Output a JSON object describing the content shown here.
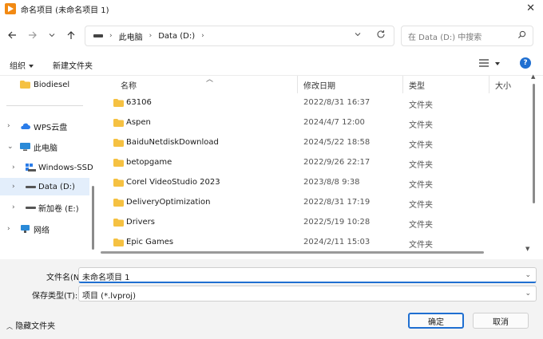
{
  "window": {
    "title": "命名项目 (未命名项目 1)"
  },
  "address_bar": {
    "breadcrumbs": [
      "此电脑",
      "Data (D:)"
    ]
  },
  "search": {
    "placeholder": "在 Data (D:) 中搜索"
  },
  "toolbar": {
    "organize_label": "组织",
    "new_folder_label": "新建文件夹"
  },
  "sidebar": {
    "items": [
      {
        "label": "Biodiesel",
        "icon": "folder-icon",
        "expandable": false
      },
      {
        "label": "WPS云盘",
        "icon": "cloud-icon",
        "expandable": true
      },
      {
        "label": "此电脑",
        "icon": "computer-icon",
        "expandable": true,
        "expanded": true
      },
      {
        "label": "Windows-SSD",
        "icon": "windows-drive-icon",
        "expandable": true
      },
      {
        "label": "Data (D:)",
        "icon": "drive-icon",
        "expandable": true,
        "selected": true
      },
      {
        "label": "新加卷 (E:)",
        "icon": "drive-icon",
        "expandable": true
      },
      {
        "label": "网络",
        "icon": "network-icon",
        "expandable": true
      }
    ]
  },
  "file_list": {
    "columns": [
      "名称",
      "修改日期",
      "类型",
      "大小"
    ],
    "rows": [
      {
        "name": "63106",
        "date": "2022/8/31 16:37",
        "type": "文件夹"
      },
      {
        "name": "Aspen",
        "date": "2024/4/7 12:00",
        "type": "文件夹"
      },
      {
        "name": "BaiduNetdiskDownload",
        "date": "2024/5/22 18:58",
        "type": "文件夹"
      },
      {
        "name": "betopgame",
        "date": "2022/9/26 22:17",
        "type": "文件夹"
      },
      {
        "name": "Corel VideoStudio 2023",
        "date": "2023/8/8 9:38",
        "type": "文件夹"
      },
      {
        "name": "DeliveryOptimization",
        "date": "2022/8/31 17:19",
        "type": "文件夹"
      },
      {
        "name": "Drivers",
        "date": "2022/5/19 10:28",
        "type": "文件夹"
      },
      {
        "name": "Epic Games",
        "date": "2024/2/11 15:03",
        "type": "文件夹"
      }
    ]
  },
  "footer": {
    "filename_label": "文件名(N):",
    "filename_value": "未命名项目 1",
    "filetype_label": "保存类型(T):",
    "filetype_value": "项目 (*.lvproj)",
    "hide_folders_label": "隐藏文件夹",
    "ok_label": "确定",
    "cancel_label": "取消"
  },
  "colors": {
    "accent": "#1f6fd1",
    "folder": "#f5c142",
    "app_icon": "#f28a13",
    "selection": "#e3eefb"
  }
}
